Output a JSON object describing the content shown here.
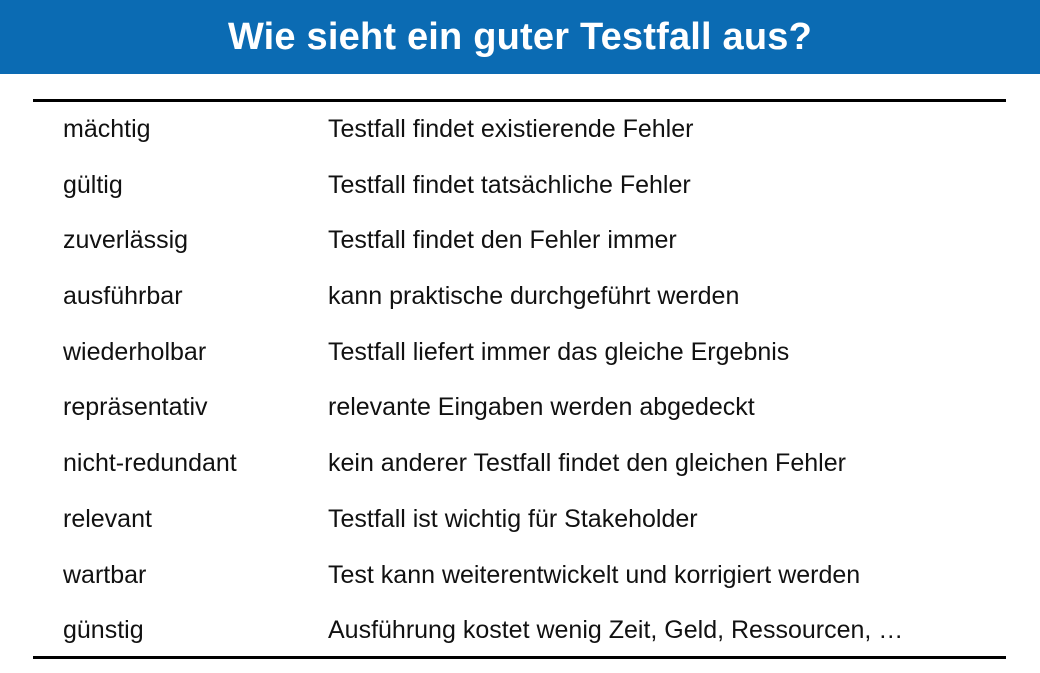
{
  "title": "Wie sieht ein guter Testfall aus?",
  "colors": {
    "title_bar": "#0b6bb3",
    "title_text": "#ffffff",
    "rules": "#000000"
  },
  "table": {
    "rows": [
      {
        "term": "mächtig",
        "description": "Testfall findet existierende Fehler"
      },
      {
        "term": "gültig",
        "description": "Testfall findet tatsächliche Fehler"
      },
      {
        "term": "zuverlässig",
        "description": "Testfall findet den Fehler immer"
      },
      {
        "term": "ausführbar",
        "description": "kann praktische durchgeführt werden"
      },
      {
        "term": "wiederholbar",
        "description": "Testfall liefert immer das gleiche Ergebnis"
      },
      {
        "term": "repräsentativ",
        "description": "relevante Eingaben werden abgedeckt"
      },
      {
        "term": "nicht-redundant",
        "description": "kein anderer Testfall findet den gleichen Fehler"
      },
      {
        "term": "relevant",
        "description": "Testfall ist wichtig für Stakeholder"
      },
      {
        "term": "wartbar",
        "description": "Test kann weiterentwickelt und korrigiert werden"
      },
      {
        "term": "günstig",
        "description": "Ausführung kostet wenig Zeit, Geld, Ressourcen, …"
      }
    ]
  }
}
